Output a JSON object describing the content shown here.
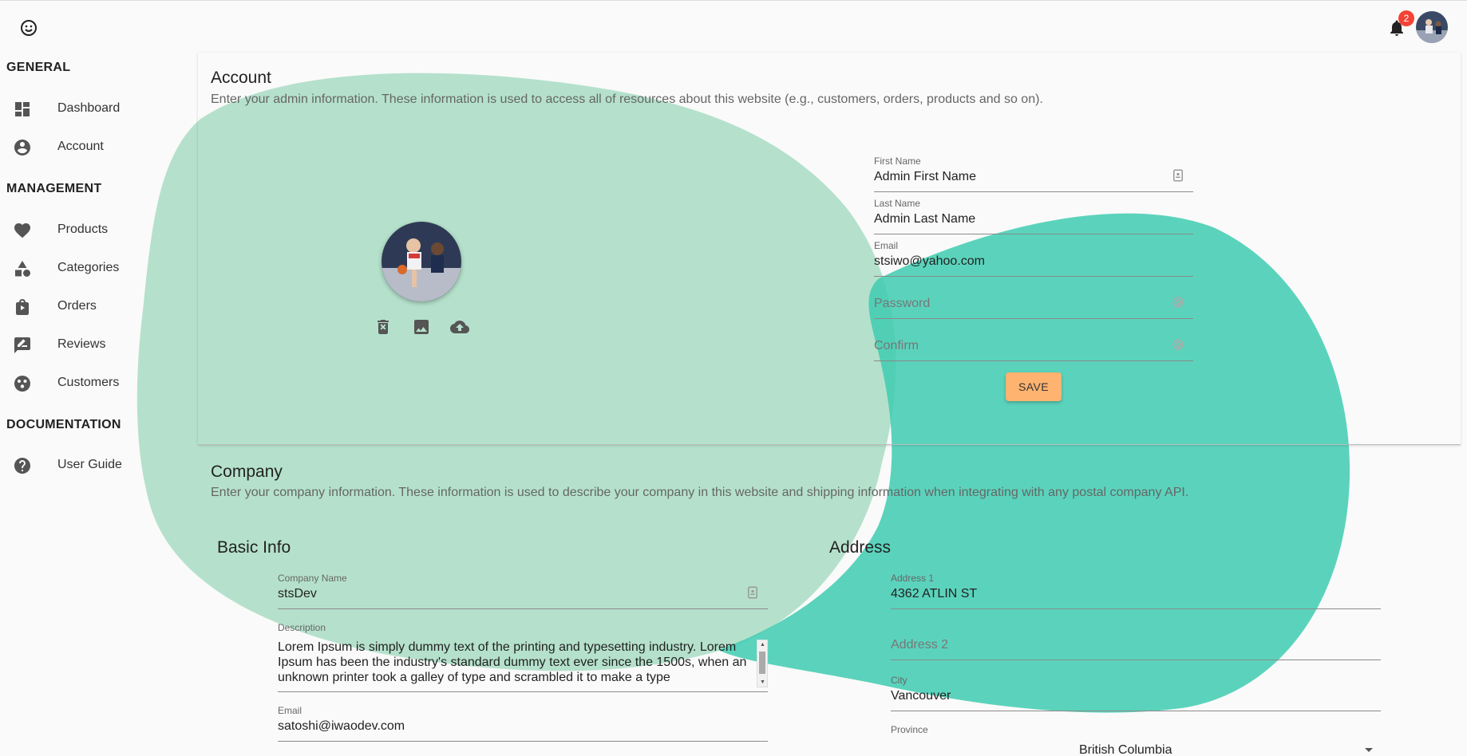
{
  "header": {
    "notification_count": "2"
  },
  "sidebar": {
    "sections": [
      {
        "title": "GENERAL"
      },
      {
        "title": "MANAGEMENT"
      },
      {
        "title": "DOCUMENTATION"
      }
    ],
    "items": [
      {
        "label": "Dashboard",
        "icon": "dashboard-icon"
      },
      {
        "label": "Account",
        "icon": "account-circle-icon"
      },
      {
        "label": "Products",
        "icon": "heart-icon"
      },
      {
        "label": "Categories",
        "icon": "category-icon"
      },
      {
        "label": "Orders",
        "icon": "shopping-bag-icon"
      },
      {
        "label": "Reviews",
        "icon": "rate-review-icon"
      },
      {
        "label": "Customers",
        "icon": "customers-icon"
      },
      {
        "label": "User Guide",
        "icon": "help-icon"
      }
    ]
  },
  "account": {
    "title": "Account",
    "description": "Enter your admin information. These information is used to access all of resources about this website (e.g., customers, orders, products and so on).",
    "first_name": {
      "label": "First Name",
      "value": "Admin First Name"
    },
    "last_name": {
      "label": "Last Name",
      "value": "Admin Last Name"
    },
    "email": {
      "label": "Email",
      "value": "stsiwo@yahoo.com"
    },
    "password": {
      "placeholder": "Password"
    },
    "confirm": {
      "placeholder": "Confirm"
    },
    "save_label": "SAVE"
  },
  "company": {
    "title": "Company",
    "description": "Enter your company information. These information is used to describe your company in this website and shipping information when integrating with any postal company API.",
    "basic_info_title": "Basic Info",
    "address_title": "Address",
    "company_name": {
      "label": "Company Name",
      "value": "stsDev"
    },
    "description_field": {
      "label": "Description",
      "value": "Lorem Ipsum is simply dummy text of the printing and typesetting industry. Lorem Ipsum has been the industry's standard dummy text ever since the 1500s, when an unknown printer took a galley of type and scrambled it to make a type"
    },
    "email": {
      "label": "Email",
      "value": "satoshi@iwaodev.com"
    },
    "address1": {
      "label": "Address 1",
      "value": "4362 ATLIN ST"
    },
    "address2": {
      "placeholder": "Address 2"
    },
    "city": {
      "label": "City",
      "value": "Vancouver"
    },
    "province": {
      "label": "Province",
      "value": "British Columbia"
    }
  },
  "colors": {
    "blob_light": "#a8dcc3",
    "blob_dark": "#3ecbb0",
    "save_button": "#ffb370",
    "badge": "#f44336"
  }
}
